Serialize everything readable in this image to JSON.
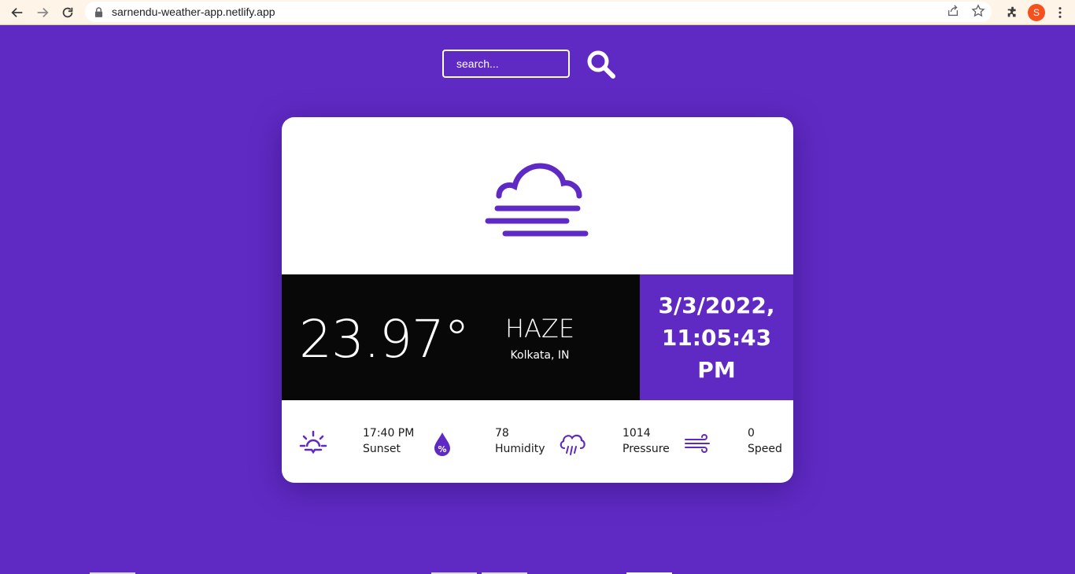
{
  "browser": {
    "url": "sarnendu-weather-app.netlify.app",
    "profile_initial": "S"
  },
  "search": {
    "placeholder": "search..."
  },
  "weather": {
    "temperature": "23.97°",
    "condition": "HAZE",
    "location": "Kolkata, IN",
    "date": "3/3/2022,",
    "time": "11:05:43 PM",
    "accent_color": "#5f2ac4"
  },
  "stats": [
    {
      "icon": "sunset-icon",
      "value": "17:40 PM",
      "label": "Sunset"
    },
    {
      "icon": "humidity-icon",
      "value": "78",
      "label": "Humidity"
    },
    {
      "icon": "pressure-icon",
      "value": "1014",
      "label": "Pressure"
    },
    {
      "icon": "wind-icon",
      "value": "0",
      "label": "Speed"
    }
  ]
}
